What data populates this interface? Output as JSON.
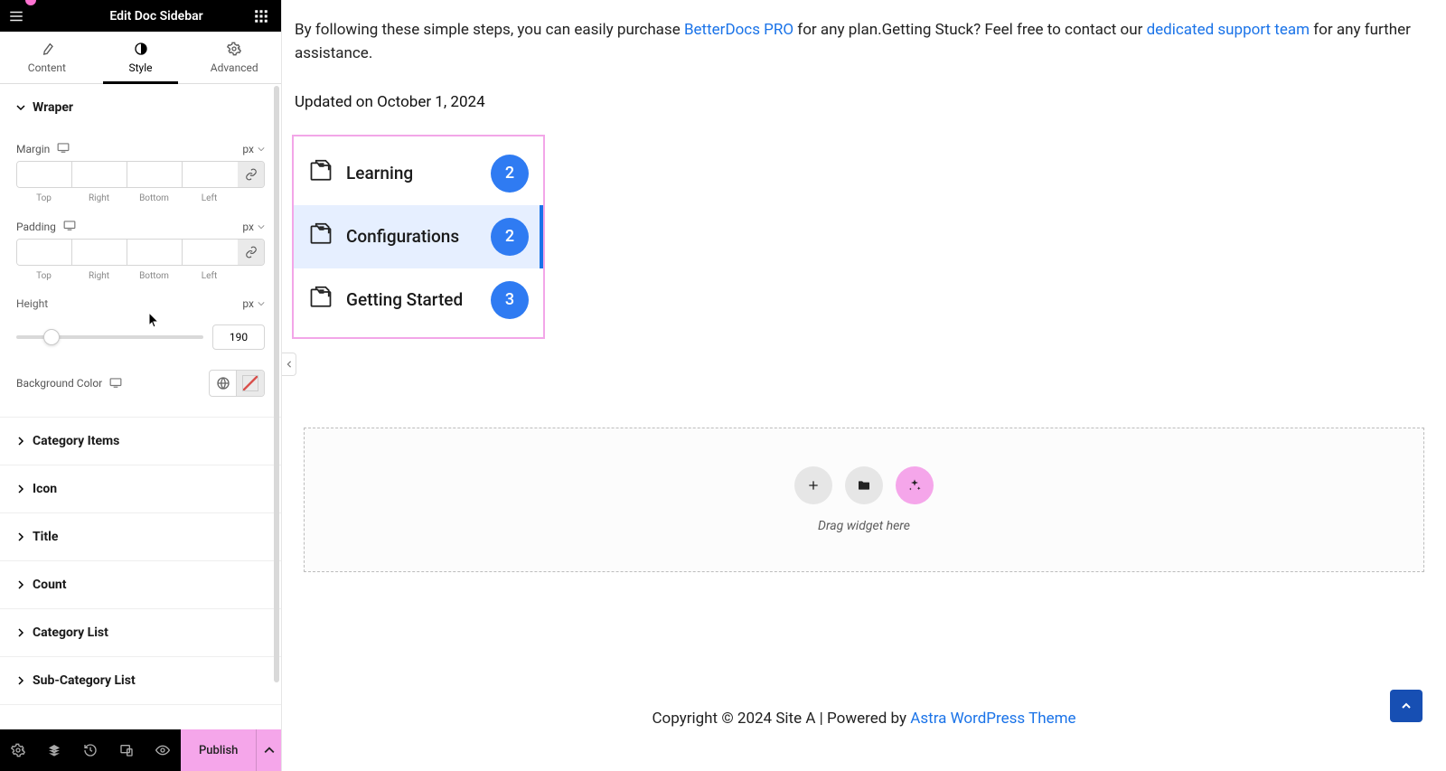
{
  "sidebar": {
    "title": "Edit Doc Sidebar",
    "tabs": {
      "content": "Content",
      "style": "Style",
      "advanced": "Advanced"
    },
    "sections": {
      "wrapper": {
        "title": "Wraper",
        "margin_label": "Margin",
        "padding_label": "Padding",
        "height_label": "Height",
        "bg_label": "Background Color",
        "unit_px": "px",
        "sides": {
          "top": "Top",
          "right": "Right",
          "bottom": "Bottom",
          "left": "Left"
        },
        "height_value": "190"
      },
      "category_items": "Category Items",
      "icon": "Icon",
      "title": "Title",
      "count": "Count",
      "category_list": "Category List",
      "sub_category_list": "Sub-Category List"
    }
  },
  "footer": {
    "publish": "Publish"
  },
  "content": {
    "paragraph_1a": "By following these simple steps, you can easily purchase ",
    "link_1": "BetterDocs PRO",
    "paragraph_1b": " for any plan.Getting Stuck? Feel free to contact our ",
    "link_2": "dedicated support team",
    "paragraph_1c": " for any further assistance.",
    "updated": "Updated on October 1, 2024",
    "docs": [
      {
        "title": "Learning",
        "count": "2"
      },
      {
        "title": "Configurations",
        "count": "2"
      },
      {
        "title": "Getting Started",
        "count": "3"
      }
    ],
    "drop_text": "Drag widget here",
    "copyright_a": "Copyright © 2024 Site A | Powered by ",
    "copyright_link": "Astra WordPress Theme"
  }
}
